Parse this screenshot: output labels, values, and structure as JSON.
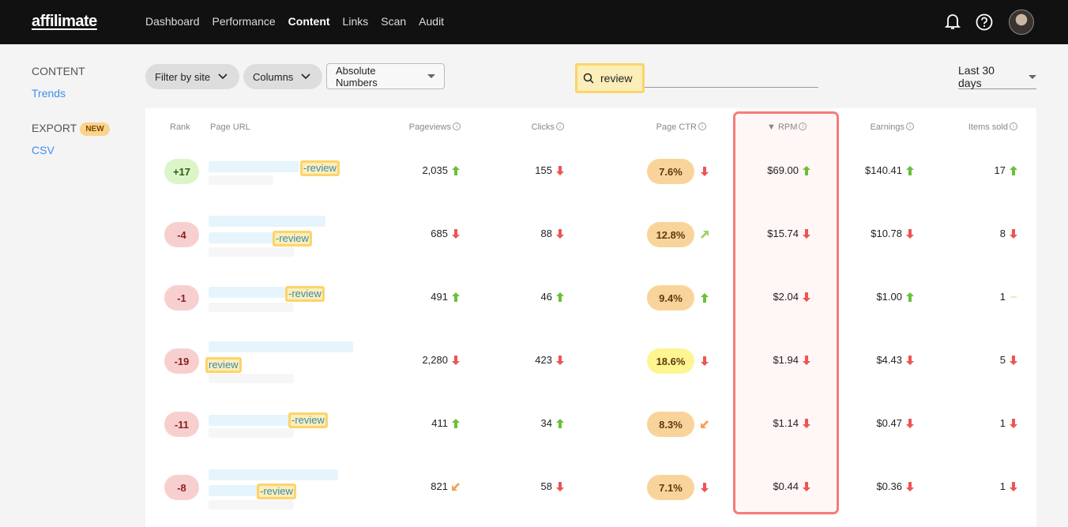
{
  "app": {
    "logo": "affilimate",
    "nav": [
      {
        "label": "Dashboard"
      },
      {
        "label": "Performance"
      },
      {
        "label": "Content",
        "active": true
      },
      {
        "label": "Links"
      },
      {
        "label": "Scan"
      },
      {
        "label": "Audit"
      }
    ],
    "icons": [
      "bell-icon",
      "help-icon",
      "avatar"
    ]
  },
  "sidebar": {
    "content_heading": "CONTENT",
    "trends": "Trends",
    "export_heading": "EXPORT",
    "new_badge": "NEW",
    "csv": "CSV"
  },
  "toolbar": {
    "filter_site": "Filter by site",
    "columns": "Columns",
    "absolute": "Absolute Numbers",
    "search_value": "review",
    "date_range": "Last 30 days"
  },
  "colors": {
    "up": "#6bbf3a",
    "down": "#ee5454",
    "highlight": "#fdd36b",
    "sort_column_border": "#f57b7b",
    "link": "#3d8ef0"
  },
  "table": {
    "headers": {
      "rank": "Rank",
      "url": "Page URL",
      "pageviews": "Pageviews",
      "clicks": "Clicks",
      "ctr": "Page CTR",
      "rpm": "RPM",
      "earnings": "Earnings",
      "items": "Items sold"
    },
    "sorted_by": "RPM",
    "sort_direction": "descending",
    "rows": [
      {
        "rank": "+17",
        "rank_trend": "up",
        "url_match": "-review",
        "pageviews": "2,035",
        "pv_trend": "up",
        "clicks": "155",
        "clicks_trend": "down",
        "ctr": "7.6%",
        "ctr_trend": "down",
        "rpm": "$69.00",
        "rpm_trend": "up",
        "earnings": "$140.41",
        "earn_trend": "up",
        "items": "17",
        "items_trend": "up"
      },
      {
        "rank": "-4",
        "rank_trend": "down",
        "url_match": "-review",
        "pageviews": "685",
        "pv_trend": "down",
        "clicks": "88",
        "clicks_trend": "down",
        "ctr": "12.8%",
        "ctr_trend": "slight-up",
        "rpm": "$15.74",
        "rpm_trend": "down",
        "earnings": "$10.78",
        "earn_trend": "down",
        "items": "8",
        "items_trend": "down"
      },
      {
        "rank": "-1",
        "rank_trend": "down",
        "url_match": "-review",
        "pageviews": "491",
        "pv_trend": "up",
        "clicks": "46",
        "clicks_trend": "up",
        "ctr": "9.4%",
        "ctr_trend": "up",
        "rpm": "$2.04",
        "rpm_trend": "down",
        "earnings": "$1.00",
        "earn_trend": "up",
        "items": "1",
        "items_trend": "flat"
      },
      {
        "rank": "-19",
        "rank_trend": "down",
        "url_match": "review",
        "pageviews": "2,280",
        "pv_trend": "down",
        "clicks": "423",
        "clicks_trend": "down",
        "ctr": "18.6%",
        "ctr_trend": "down",
        "ctr_color": "#fdf58f",
        "rpm": "$1.94",
        "rpm_trend": "down",
        "earnings": "$4.43",
        "earn_trend": "down",
        "items": "5",
        "items_trend": "down"
      },
      {
        "rank": "-11",
        "rank_trend": "down",
        "url_match": "-review",
        "pageviews": "411",
        "pv_trend": "up",
        "clicks": "34",
        "clicks_trend": "up",
        "ctr": "8.3%",
        "ctr_trend": "slight-down",
        "rpm": "$1.14",
        "rpm_trend": "down",
        "earnings": "$0.47",
        "earn_trend": "down",
        "items": "1",
        "items_trend": "down"
      },
      {
        "rank": "-8",
        "rank_trend": "down",
        "url_match": "-review",
        "pageviews": "821",
        "pv_trend": "slight-down",
        "clicks": "58",
        "clicks_trend": "down",
        "ctr": "7.1%",
        "ctr_trend": "down",
        "rpm": "$0.44",
        "rpm_trend": "down",
        "earnings": "$0.36",
        "earn_trend": "down",
        "items": "1",
        "items_trend": "down"
      }
    ]
  }
}
